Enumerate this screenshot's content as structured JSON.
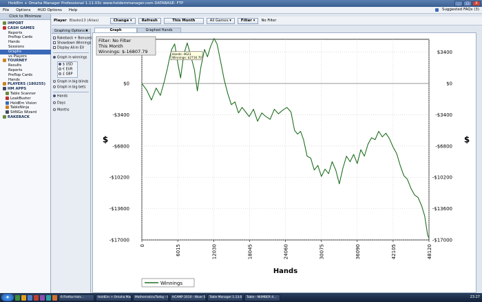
{
  "window": {
    "title": "HoldEm + Omaha Manager Professional 1.11.03c     www.holdemmanager.com     DATABASE: FTP",
    "controls": [
      "_",
      "□",
      "X"
    ]
  },
  "menu": {
    "items": [
      "File",
      "Options",
      "HUD Options",
      "Help"
    ],
    "suggested": "Suggested FAQs (3)"
  },
  "sidebar": {
    "minimize": "Click to Minimize",
    "items": [
      {
        "label": "IMPORT",
        "type": "header"
      },
      {
        "label": "CASH GAMES",
        "type": "header"
      },
      {
        "label": "Reports",
        "type": "item"
      },
      {
        "label": "Preflop Cards",
        "type": "item"
      },
      {
        "label": "Hands",
        "type": "item"
      },
      {
        "label": "Sessions",
        "type": "item"
      },
      {
        "label": "Graphs",
        "type": "selected"
      },
      {
        "label": "vs Players",
        "type": "item"
      },
      {
        "label": "TOURNEY",
        "type": "header"
      },
      {
        "label": "Results",
        "type": "item"
      },
      {
        "label": "Reports",
        "type": "item"
      },
      {
        "label": "Preflop Cards",
        "type": "item"
      },
      {
        "label": "Hands",
        "type": "item"
      },
      {
        "label": "PLAYERS (180255)",
        "type": "header"
      },
      {
        "label": "HM APPS",
        "type": "header"
      },
      {
        "label": "Table Scanner",
        "type": "app"
      },
      {
        "label": "LeakBuster",
        "type": "app"
      },
      {
        "label": "HoldEm Vision",
        "type": "app"
      },
      {
        "label": "TableNinja",
        "type": "app"
      },
      {
        "label": "SitNGo Wizard",
        "type": "app"
      },
      {
        "label": "RAKEBACK",
        "type": "header"
      }
    ]
  },
  "toolbar": {
    "player_label": "Player",
    "player_value": "Blasko13 (Alias)",
    "change": "Change",
    "refresh": "Refresh",
    "date": "This Month",
    "games": "All Games",
    "filter": "Filter",
    "filter_status": "No Filter"
  },
  "graph_options": {
    "header": "Graphing Options",
    "checks": [
      "Rakeback + Bonuses",
      "Showdown Winnings",
      "Display All-In EV"
    ],
    "in_winnings": "Graph in winnings",
    "currencies": [
      "$ USD",
      "€ EUR",
      "£ GBP"
    ],
    "in_bb": "Graph in big blinds",
    "in_bets": "Graph in big bets",
    "periods": [
      "Hands",
      "Days",
      "Months"
    ]
  },
  "tabs": {
    "graph": "Graph",
    "graphed_hands": "Graphed Hands"
  },
  "chart_data": {
    "type": "line",
    "info_lines": [
      "Filter: No Filter",
      "This Month",
      "Winnings: $-16807.79"
    ],
    "tooltip": [
      "Hands: 4623",
      "Winnings: $2716.70"
    ],
    "xlabel": "Hands",
    "ylabel": "$",
    "x_ticks": [
      0,
      6015,
      12030,
      18045,
      24060,
      30075,
      36090,
      42105,
      48120
    ],
    "y_ticks": [
      3400,
      0,
      -3400,
      -6800,
      -10200,
      -13600,
      -17000
    ],
    "y_tick_labels": [
      "$3400",
      "$0",
      "-$3400",
      "-$6800",
      "-$10200",
      "-$13600",
      "-$17000"
    ],
    "xlim": [
      0,
      48120
    ],
    "ylim": [
      -17000,
      4800
    ],
    "grid": true,
    "legend": "bottom-left",
    "series": [
      {
        "name": "Winnings",
        "color": "#1e6e1e",
        "points": [
          [
            0,
            0
          ],
          [
            800,
            -700
          ],
          [
            1600,
            -1800
          ],
          [
            2400,
            -500
          ],
          [
            3100,
            -1300
          ],
          [
            3800,
            300
          ],
          [
            4300,
            1700
          ],
          [
            4623,
            2717
          ],
          [
            5000,
            3700
          ],
          [
            5500,
            4300
          ],
          [
            6000,
            2300
          ],
          [
            6500,
            600
          ],
          [
            7000,
            3100
          ],
          [
            7600,
            4400
          ],
          [
            8200,
            3000
          ],
          [
            8800,
            1500
          ],
          [
            9300,
            -800
          ],
          [
            9900,
            1800
          ],
          [
            10500,
            3700
          ],
          [
            11000,
            2900
          ],
          [
            11500,
            4000
          ],
          [
            12100,
            4900
          ],
          [
            12600,
            4300
          ],
          [
            13200,
            2400
          ],
          [
            13800,
            400
          ],
          [
            14400,
            -1100
          ],
          [
            15000,
            -2300
          ],
          [
            15600,
            -2000
          ],
          [
            16200,
            -3200
          ],
          [
            16800,
            -2600
          ],
          [
            17400,
            -3100
          ],
          [
            18000,
            -3600
          ],
          [
            18700,
            -2800
          ],
          [
            19400,
            -4100
          ],
          [
            20100,
            -3200
          ],
          [
            20800,
            -3600
          ],
          [
            21500,
            -3900
          ],
          [
            22200,
            -2800
          ],
          [
            22900,
            -3300
          ],
          [
            23600,
            -2900
          ],
          [
            24300,
            -2600
          ],
          [
            25000,
            -3100
          ],
          [
            25600,
            -5100
          ],
          [
            26100,
            -5500
          ],
          [
            26600,
            -5200
          ],
          [
            27100,
            -6100
          ],
          [
            27700,
            -7900
          ],
          [
            28300,
            -8100
          ],
          [
            28900,
            -9400
          ],
          [
            29500,
            -8900
          ],
          [
            30100,
            -10100
          ],
          [
            30700,
            -9300
          ],
          [
            31300,
            -9800
          ],
          [
            31900,
            -8500
          ],
          [
            32500,
            -9400
          ],
          [
            33100,
            -10900
          ],
          [
            33700,
            -9200
          ],
          [
            34300,
            -7900
          ],
          [
            34900,
            -8500
          ],
          [
            35500,
            -7700
          ],
          [
            36100,
            -8700
          ],
          [
            36700,
            -7200
          ],
          [
            37300,
            -7900
          ],
          [
            37900,
            -6600
          ],
          [
            38500,
            -5900
          ],
          [
            39100,
            -6100
          ],
          [
            39700,
            -5200
          ],
          [
            40300,
            -5800
          ],
          [
            40900,
            -5400
          ],
          [
            41500,
            -6000
          ],
          [
            42100,
            -6900
          ],
          [
            42700,
            -7600
          ],
          [
            43300,
            -8900
          ],
          [
            43900,
            -10000
          ],
          [
            44500,
            -10400
          ],
          [
            45100,
            -11400
          ],
          [
            45700,
            -12100
          ],
          [
            46300,
            -12400
          ],
          [
            46900,
            -13300
          ],
          [
            47400,
            -14400
          ],
          [
            47900,
            -16500
          ],
          [
            48120,
            -16808
          ]
        ]
      }
    ]
  },
  "taskbar": {
    "tasks": [
      "6 Firefox-Hols...",
      "HoldEm + Omaha Man...",
      "Mathematics/Today - Li...",
      "HCAMP 2010 - Wuer S...",
      "Table Manager 1.13.01...",
      "Table - NUMBER 4..."
    ],
    "clock": "23:27"
  }
}
